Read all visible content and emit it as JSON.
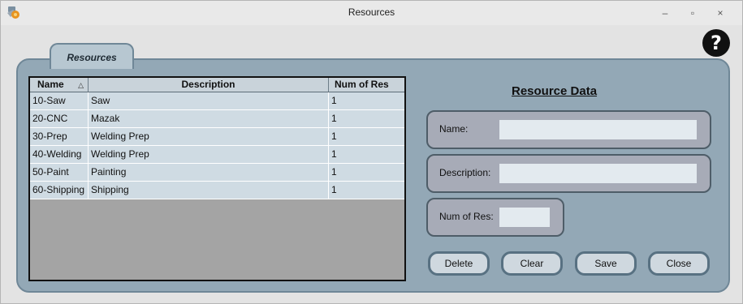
{
  "window": {
    "title": "Resources",
    "controls": {
      "minimize": "–",
      "maximize": "▫",
      "close": "×"
    }
  },
  "help": {
    "label": "?"
  },
  "tab": {
    "label": "Resources"
  },
  "table": {
    "columns": [
      "Name",
      "Description",
      "Num of Res"
    ],
    "sort_indicator": "△",
    "rows": [
      {
        "name": "10-Saw",
        "description": "Saw",
        "num": "1"
      },
      {
        "name": "20-CNC",
        "description": "Mazak",
        "num": "1"
      },
      {
        "name": "30-Prep",
        "description": "Welding Prep",
        "num": "1"
      },
      {
        "name": "40-Welding",
        "description": "Welding Prep",
        "num": "1"
      },
      {
        "name": "50-Paint",
        "description": "Painting",
        "num": "1"
      },
      {
        "name": "60-Shipping",
        "description": "Shipping",
        "num": "1"
      }
    ]
  },
  "resource_data": {
    "title": "Resource Data",
    "name_label": "Name:",
    "name_value": "",
    "description_label": "Description:",
    "description_value": "",
    "num_label": "Num of Res:",
    "num_value": ""
  },
  "buttons": {
    "delete": "Delete",
    "clear": "Clear",
    "save": "Save",
    "close": "Close"
  },
  "colors": {
    "panel": "#93a8b6",
    "table_row": "#cfdbe3",
    "field_box": "#a7abb7",
    "button_border": "#587182"
  }
}
